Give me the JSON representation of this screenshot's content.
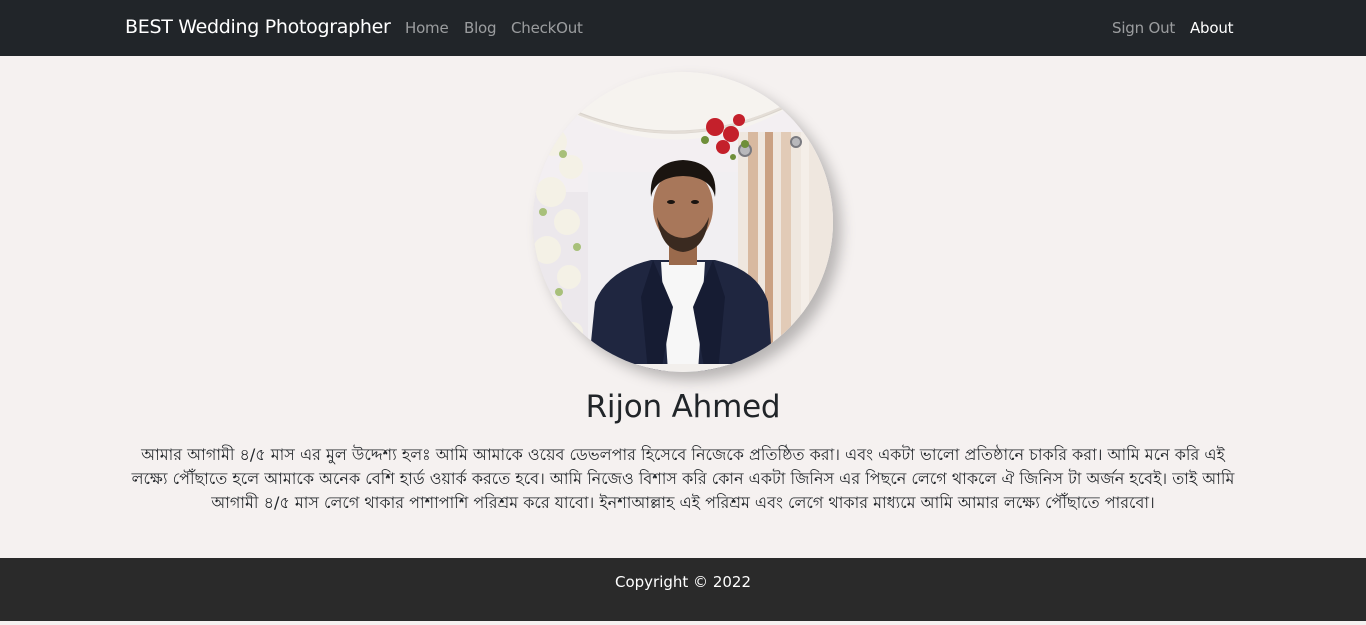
{
  "navbar": {
    "brand": "BEST Wedding Photographer",
    "links": [
      {
        "label": "Home"
      },
      {
        "label": "Blog"
      },
      {
        "label": "CheckOut"
      }
    ],
    "right_links": [
      {
        "label": "Sign Out"
      },
      {
        "label": "About"
      }
    ]
  },
  "profile": {
    "name": "Rijon Ahmed",
    "bio": "আমার আগামী ৪/৫ মাস এর মুল উদ্দেশ্য হলঃ আমি আমাকে ওয়েব ডেভলপার হিসেবে নিজেকে প্রতিষ্ঠিত করা। এবং একটা ভালো প্রতিষ্ঠানে চাকরি করা। আমি মনে করি এই লক্ষ্যে পৌঁছাতে হলে আমাকে অনেক বেশি হার্ড ওয়ার্ক করতে হবে। আমি নিজেও বিশাস করি কোন একটা জিনিস এর পিছনে লেগে থাকলে ঐ জিনিস টা অর্জন হবেই। তাই আমি আগামী ৪/৫ মাস লেগে থাকার পাশাপাশি পরিশ্রম করে যাবো। ইনশাআল্লাহ এই পরিশ্রম এবং লেগে থাকার মাধ্যমে আমি আমার লক্ষ্যে পৌঁছাতে পারবো।"
  },
  "footer": {
    "copyright": "Copyright © 2022"
  }
}
